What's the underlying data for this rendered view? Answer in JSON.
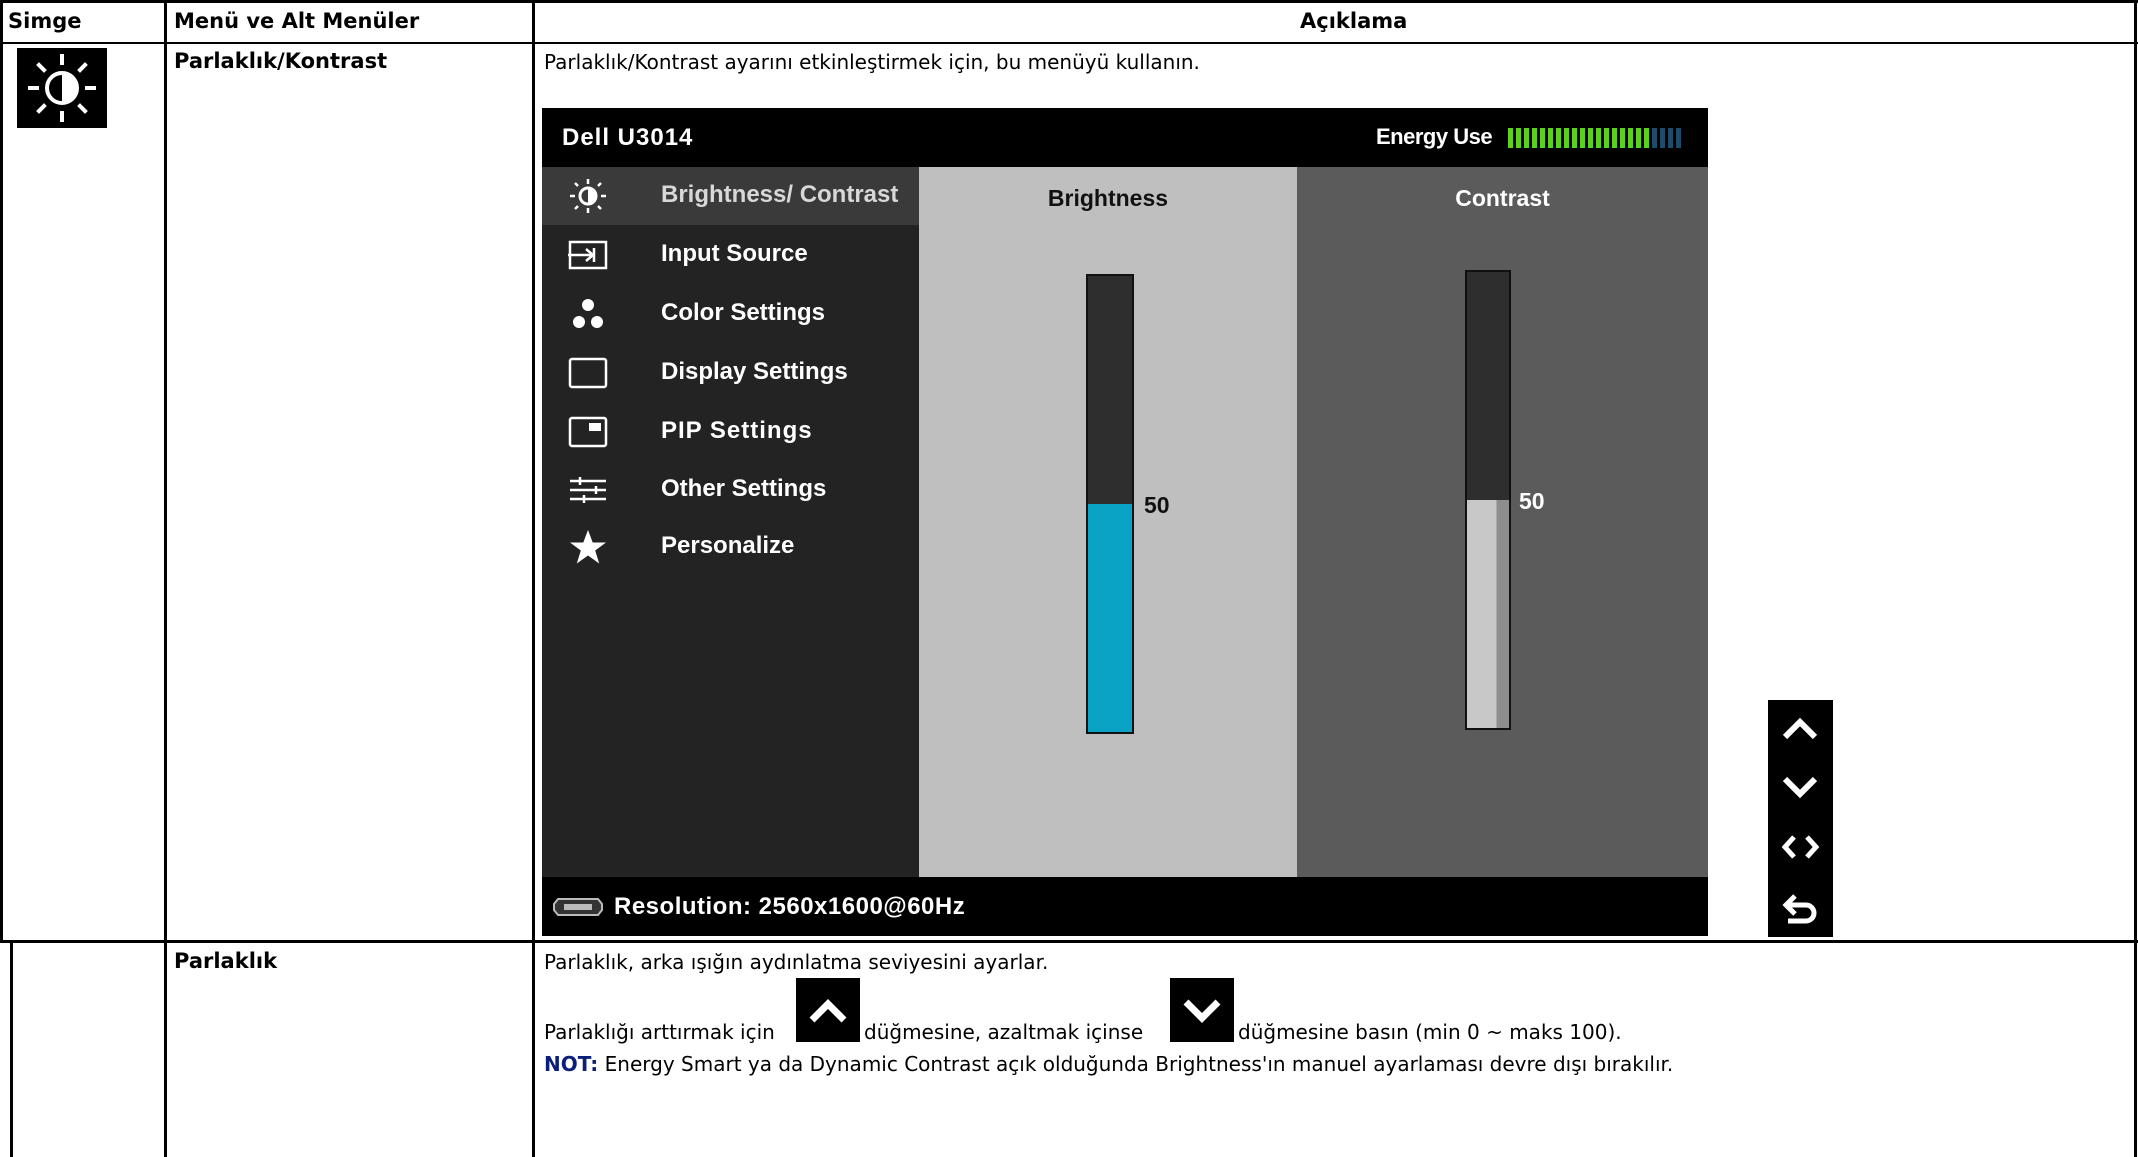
{
  "table": {
    "headers": [
      "Simge",
      "Menü ve Alt Menüler",
      "Açıklama"
    ],
    "row1": {
      "menu": "Parlaklık/Kontrast",
      "description": "Parlaklık/Kontrast ayarını etkinleştirmek için, bu menüyü kullanın."
    },
    "row2": {
      "menu": "Parlaklık",
      "line1": "Parlaklık, arka ışığın aydınlatma seviyesini ayarlar.",
      "line2_a": "Parlaklığı arttırmak için",
      "line2_b": "düğmesine, azaltmak içinse",
      "line2_c": "düğmesine basın (min 0 ~ maks 100).",
      "note_label": "NOT:",
      "note_text": "Energy Smart ya da Dynamic Contrast açık olduğunda Brightness'ın manuel ayarlaması devre dışı bırakılır."
    }
  },
  "osd": {
    "model": "Dell U3014",
    "energy_label": "Energy Use",
    "energy_level": 0.8,
    "menu_items": [
      {
        "label": "Brightness/ Contrast",
        "icon": "brightness-icon",
        "selected": true
      },
      {
        "label": "Input Source",
        "icon": "input-source-icon"
      },
      {
        "label": "Color Settings",
        "icon": "color-settings-icon"
      },
      {
        "label": "Display Settings",
        "icon": "display-settings-icon"
      },
      {
        "label": "PIP Settings",
        "icon": "pip-settings-icon"
      },
      {
        "label": "Other Settings",
        "icon": "other-settings-icon"
      },
      {
        "label": "Personalize",
        "icon": "star-icon"
      }
    ],
    "brightness": {
      "label": "Brightness",
      "value": "50",
      "level": 0.5,
      "color": "#0aa3c6"
    },
    "contrast": {
      "label": "Contrast",
      "value": "50",
      "level": 0.5,
      "color": "#c8c8c8"
    },
    "resolution": "Resolution: 2560x1600@60Hz"
  },
  "nav_buttons": [
    "up-arrow-icon",
    "down-arrow-icon",
    "left-right-arrow-icon",
    "back-icon"
  ],
  "colors": {
    "note": "#0a1f7a",
    "panel_brightness": "#bfbfbf",
    "panel_contrast": "#5b5b5b"
  }
}
